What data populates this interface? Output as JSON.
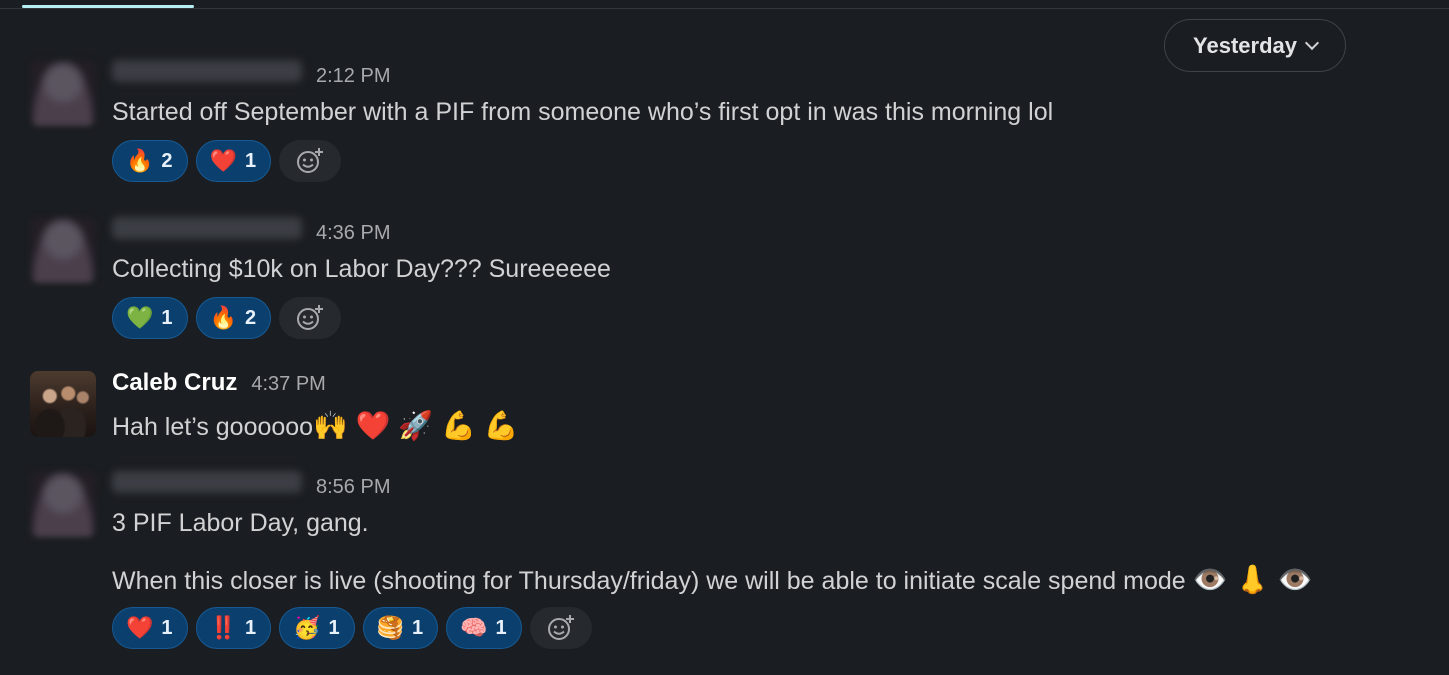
{
  "top_tab": {
    "active": true
  },
  "date_divider": {
    "label": "Yesterday"
  },
  "messages": [
    {
      "time": "2:12 PM",
      "text": "Started off September with a PIF from someone who’s first opt in was this morning lol",
      "reactions": [
        {
          "emoji": "🔥",
          "count": "2"
        },
        {
          "emoji": "❤️",
          "count": "1"
        }
      ]
    },
    {
      "time": "4:36 PM",
      "text": "Collecting $10k on Labor Day??? Sureeeeee",
      "reactions": [
        {
          "emoji": "💚",
          "count": "1"
        },
        {
          "emoji": "🔥",
          "count": "2"
        }
      ]
    },
    {
      "author": "Caleb Cruz",
      "time": "4:37 PM",
      "text": "Hah let’s goooooo",
      "emojis": "🙌 ❤️ 🚀 💪 💪"
    },
    {
      "time": "8:56 PM",
      "text": "3 PIF Labor Day, gang.",
      "text2": "When this closer is live (shooting for Thursday/friday) we will be able to initiate scale spend mode",
      "emojis2": "👁️ 👃 👁️",
      "reactions": [
        {
          "emoji": "❤️",
          "count": "1"
        },
        {
          "emoji": "‼️",
          "count": "1"
        },
        {
          "emoji": "🥳",
          "count": "1"
        },
        {
          "emoji": "🥞",
          "count": "1"
        },
        {
          "emoji": "🧠",
          "count": "1"
        }
      ]
    }
  ],
  "icons": {
    "add_reaction": "add-reaction-icon",
    "chevron": "chevron-down-icon"
  }
}
